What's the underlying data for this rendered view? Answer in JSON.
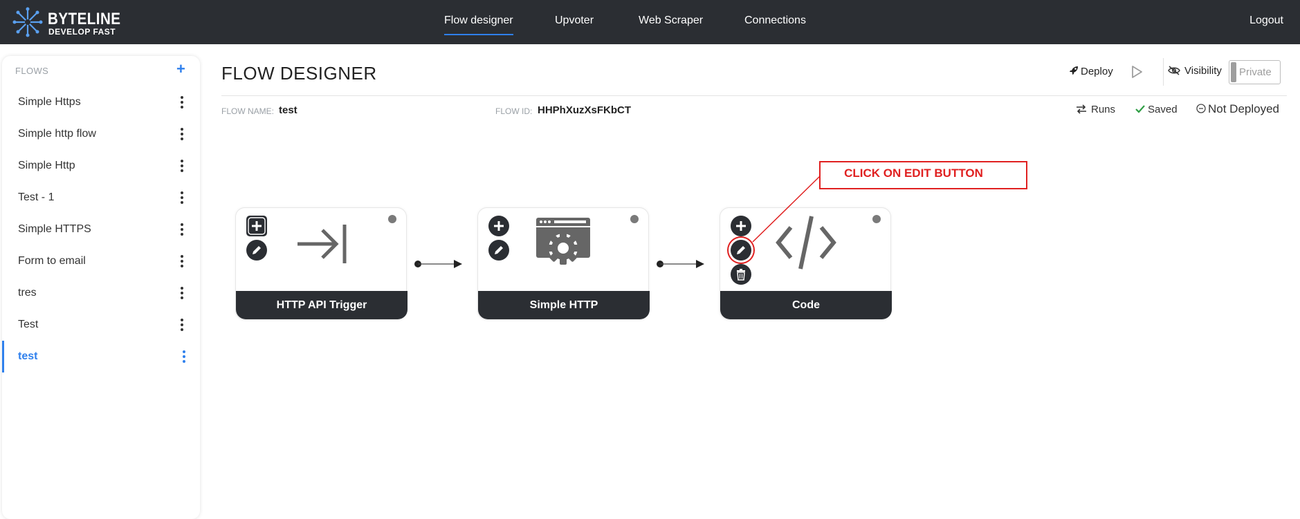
{
  "app": {
    "logo_title": "BYTELINE",
    "logo_subtitle": "DEVELOP FAST",
    "accent_color": "#2f80ed",
    "nav_bg": "#2b2e33"
  },
  "nav": {
    "items": [
      {
        "label": "Flow designer",
        "active": true
      },
      {
        "label": "Upvoter",
        "active": false
      },
      {
        "label": "Web Scraper",
        "active": false
      },
      {
        "label": "Connections",
        "active": false
      }
    ],
    "logout": "Logout"
  },
  "sidebar": {
    "header": "FLOWS",
    "add_icon": "plus-icon",
    "items": [
      {
        "label": "Simple Https"
      },
      {
        "label": "Simple http flow"
      },
      {
        "label": "Simple Http"
      },
      {
        "label": "Test - 1"
      },
      {
        "label": "Simple HTTPS"
      },
      {
        "label": "Form to email"
      },
      {
        "label": "tres"
      },
      {
        "label": "Test"
      },
      {
        "label": "test",
        "active": true
      }
    ]
  },
  "header": {
    "title": "FLOW DESIGNER",
    "deploy": "Deploy",
    "visibility": "Visibility",
    "private": "Private",
    "flow_name_label": "FLOW NAME:",
    "flow_name": "test",
    "flow_id_label": "FLOW ID:",
    "flow_id": "HHPhXuzXsFKbCT",
    "runs": "Runs",
    "saved": "Saved",
    "deploy_status": "Not Deployed"
  },
  "nodes": [
    {
      "title": "HTTP API Trigger",
      "icon": "arrow-to-line-icon"
    },
    {
      "title": "Simple HTTP",
      "icon": "browser-gear-icon"
    },
    {
      "title": "Code",
      "icon": "code-icon"
    }
  ],
  "annotation": {
    "text": "CLICK ON EDIT BUTTON",
    "color": "#e02020"
  }
}
